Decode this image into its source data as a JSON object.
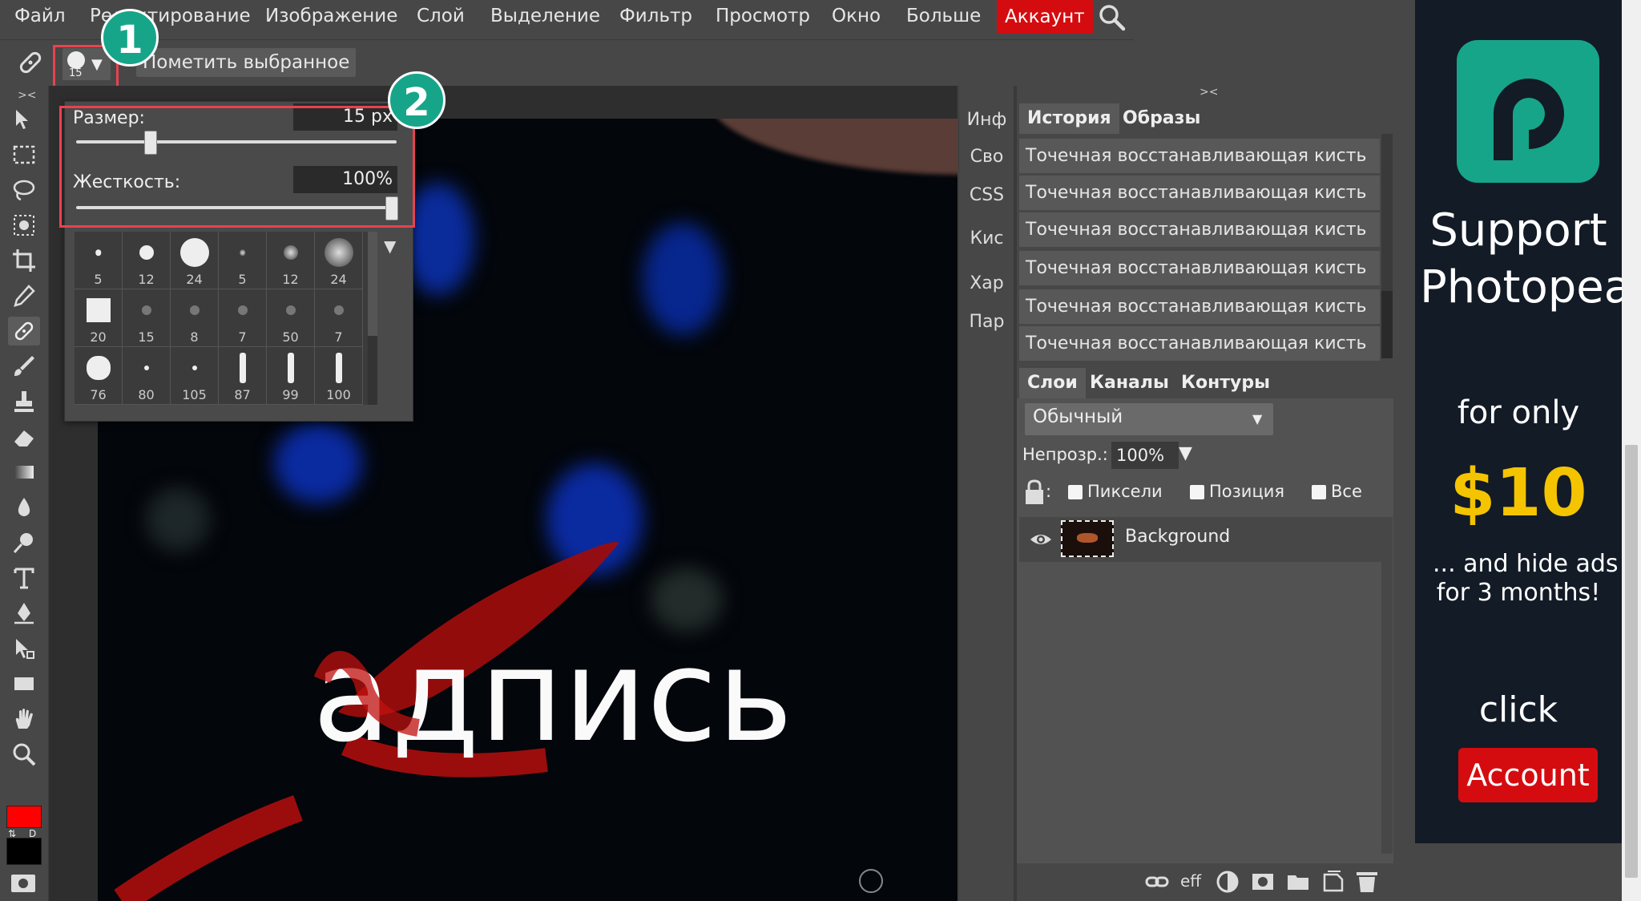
{
  "menu": {
    "items": [
      "Файл",
      "Редактирование",
      "Изображение",
      "Слой",
      "Выделение",
      "Фильтр",
      "Просмотр",
      "Окно",
      "Больше"
    ],
    "account": "Аккаунт"
  },
  "options": {
    "brush_size": "15",
    "mark_selected": "Пометить выбранное"
  },
  "brush_panel": {
    "size_label": "Размер:",
    "size_value": "15 px",
    "hardness_label": "Жесткость:",
    "hardness_value": "100%",
    "size_fraction": 0.22,
    "hardness_fraction": 1.0,
    "brushes": [
      "5",
      "12",
      "24",
      "5",
      "12",
      "24",
      "20",
      "15",
      "8",
      "7",
      "50",
      "7",
      "76",
      "80",
      "105",
      "87",
      "99",
      "100"
    ]
  },
  "annotations": {
    "badge1": "1",
    "badge2": "2"
  },
  "canvas": {
    "text": "адпись"
  },
  "mini_panel": [
    "Инф",
    "Сво",
    "CSS",
    "Кис",
    "Хар",
    "Пар"
  ],
  "history": {
    "tabs": [
      "История",
      "Образы"
    ],
    "rows": [
      "Точечная восстанавливающая кисть",
      "Точечная восстанавливающая кисть",
      "Точечная восстанавливающая кисть",
      "Точечная восстанавливающая кисть",
      "Точечная восстанавливающая кисть",
      "Точечная восстанавливающая кисть"
    ]
  },
  "layers": {
    "tabs": [
      "Слои",
      "Каналы",
      "Контуры"
    ],
    "blend_mode": "Обычный",
    "opacity_label": "Непрозр.:",
    "opacity_value": "100%",
    "lock_pixels": "Пиксели",
    "lock_position": "Позиция",
    "lock_all": "Все",
    "layer_name": "Background",
    "footer_eff": "eff"
  },
  "ad": {
    "line1": "Support",
    "line2": "Photopea",
    "line3": "for only",
    "price": "$10",
    "line4": "... and hide ads",
    "line5": "for 3 months!",
    "click": "click",
    "button": "Account"
  },
  "colors": {
    "foreground": "#ff0000",
    "background": "#000000",
    "accent": "#d40c10",
    "badge": "#17a589"
  }
}
